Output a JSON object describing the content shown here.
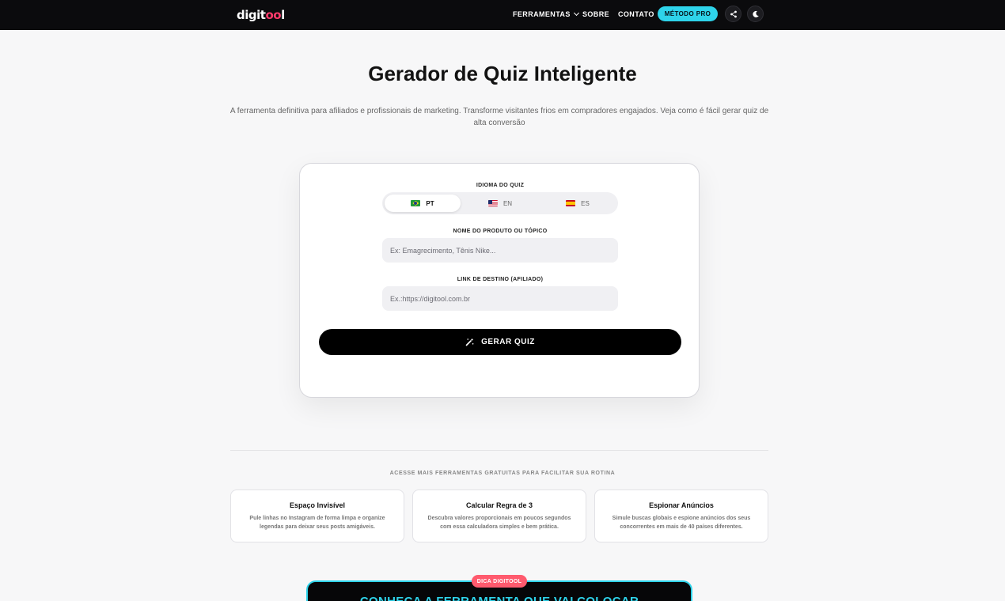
{
  "header": {
    "logo_prefix": "digit",
    "logo_accent": "oo",
    "logo_suffix": "l",
    "nav": {
      "ferramentas": "FERRAMENTAS",
      "sobre": "SOBRE",
      "contato": "CONTATO"
    },
    "cta_label": "MÉTODO PRO",
    "icons": [
      "share-icon",
      "moon-icon"
    ]
  },
  "hero": {
    "title": "Gerador de Quiz Inteligente",
    "subtitle": "A ferramenta definitiva para afiliados e profissionais de marketing. Transforme visitantes frios em compradores engajados. Veja como é fácil gerar quiz de alta conversão"
  },
  "form": {
    "language_label": "IDIOMA DO QUIZ",
    "languages": [
      {
        "code": "PT",
        "flag": "brazil-flag",
        "selected": true
      },
      {
        "code": "EN",
        "flag": "usa-flag",
        "selected": false
      },
      {
        "code": "ES",
        "flag": "spain-flag",
        "selected": false
      }
    ],
    "product_label": "NOME DO PRODUTO OU TÓPICO",
    "product_placeholder": "Ex: Emagrecimento, Tênis Nike...",
    "product_value": "",
    "link_label": "LINK DE DESTINO (AFILIADO)",
    "link_placeholder": "Ex.:https://digitool.com.br",
    "link_value": "",
    "submit_label": "GERAR QUIZ"
  },
  "tools": {
    "heading": "ACESSE MAIS FERRAMENTAS GRATUITAS PARA FACILITAR SUA ROTINA",
    "items": [
      {
        "title": "Espaço Invisível",
        "description": "Pule linhas no Instagram de forma limpa e organize legendas para deixar seus posts amigáveis."
      },
      {
        "title": "Calcular Regra de 3",
        "description": "Descubra valores proporcionais em poucos segundos com essa calculadora simples e bem prática."
      },
      {
        "title": "Espionar Anúncios",
        "description": "Simule buscas globais e espione anúncios dos seus concorrentes em mais de 40 países diferentes."
      }
    ]
  },
  "promo": {
    "badge": "DICA DIGITOOL",
    "headline": "CONHEÇA A FERRAMENTA QUE VAI COLOCAR"
  },
  "colors": {
    "accent": "#2ed3ea",
    "badge": "#ff5a6e",
    "logo_accent": "#ff3b6b",
    "header_bg": "#0b0b0d"
  }
}
